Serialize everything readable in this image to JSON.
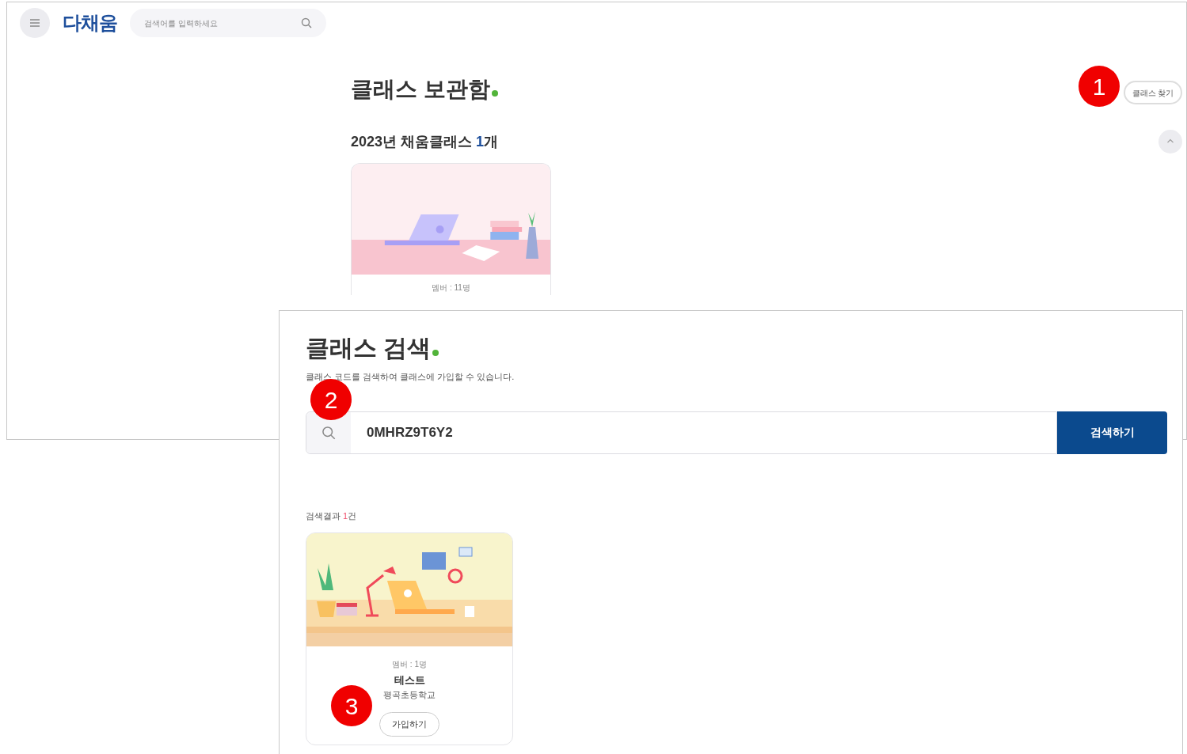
{
  "header": {
    "logo": "다채움",
    "search_placeholder": "검색어를 입력하세요"
  },
  "archive": {
    "title": "클래스 보관함",
    "find_button": "클래스 찾기",
    "group": {
      "label_prefix": "2023년 채움클래스 ",
      "count": "1",
      "label_suffix": "개",
      "expanded": true
    },
    "cards": [
      {
        "members": "멤버 : 11명"
      }
    ]
  },
  "search_panel": {
    "title": "클래스 검색",
    "description": "클래스 코드를 검색하여 클래스에 가입할 수 있습니다.",
    "query": "0MHRZ9T6Y2",
    "search_button": "검색하기",
    "result_prefix": "검색결과 ",
    "result_count": "1",
    "result_suffix": "건",
    "results": [
      {
        "members": "멤버 : 1명",
        "name": "테스트",
        "school": "평곡초등학교",
        "join_button": "가입하기"
      }
    ]
  },
  "step_markers": [
    "1",
    "2",
    "3"
  ]
}
